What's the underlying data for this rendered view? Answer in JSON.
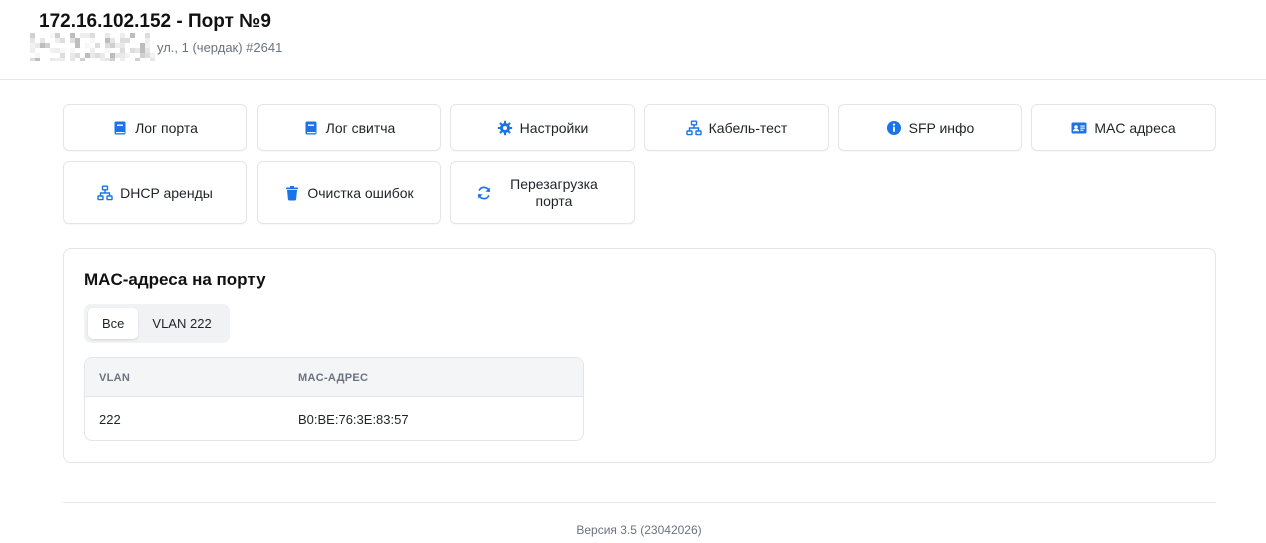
{
  "header": {
    "title": "172.16.102.152 - Порт №9",
    "address_visible": "ул., 1 (чердак) #2641"
  },
  "actions": [
    {
      "label": "Лог порта",
      "icon": "book-icon"
    },
    {
      "label": "Лог свитча",
      "icon": "book-icon"
    },
    {
      "label": "Настройки",
      "icon": "gear-icon"
    },
    {
      "label": "Кабель-тест",
      "icon": "network-icon"
    },
    {
      "label": "SFP инфо",
      "icon": "info-icon"
    },
    {
      "label": "MAC адреса",
      "icon": "id-card-icon"
    },
    {
      "label": "DHCP аренды",
      "icon": "network-icon"
    },
    {
      "label": "Очистка ошибок",
      "icon": "trash-icon"
    },
    {
      "label": "Перезагрузка порта",
      "icon": "refresh-icon"
    }
  ],
  "mac_panel": {
    "title": "MAC-адреса на порту",
    "tabs": [
      {
        "label": "Все",
        "active": true
      },
      {
        "label": "VLAN 222",
        "active": false
      }
    ],
    "columns": [
      "VLAN",
      "MAC-АДРЕС"
    ],
    "rows": [
      {
        "vlan": "222",
        "mac": "B0:BE:76:3E:83:57"
      }
    ]
  },
  "footer": {
    "version": "Версия 3.5 (23042026)"
  },
  "colors": {
    "accent": "#1a73e8",
    "border": "#e3e5e8",
    "muted_text": "#6b7280"
  }
}
